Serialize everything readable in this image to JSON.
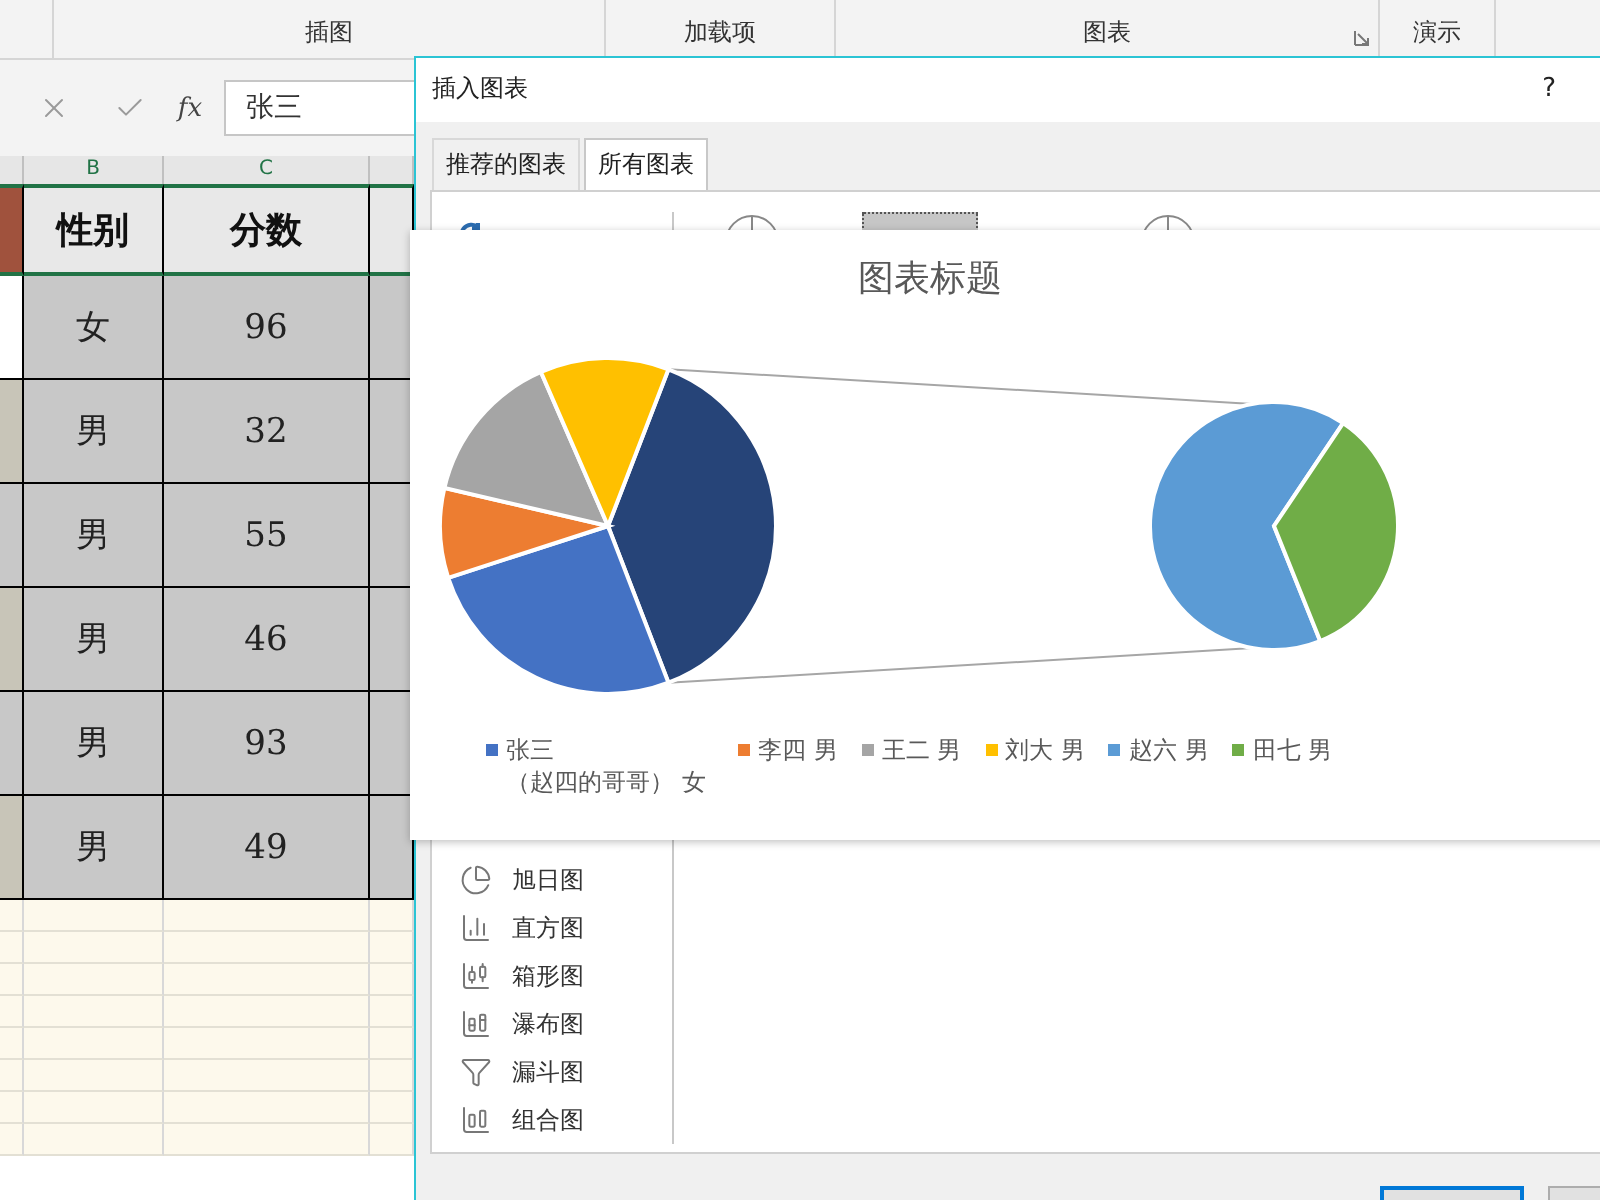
{
  "ribbon": {
    "groups": [
      "插图",
      "加载项",
      "图表",
      "演示"
    ]
  },
  "formula_bar": {
    "fx": "fx",
    "value": "张三"
  },
  "sheet": {
    "column_headers": [
      "B",
      "C"
    ],
    "header": [
      "性别",
      "分数"
    ],
    "rows": [
      {
        "gender": "女",
        "score": "96"
      },
      {
        "gender": "男",
        "score": "32"
      },
      {
        "gender": "男",
        "score": "55"
      },
      {
        "gender": "男",
        "score": "46"
      },
      {
        "gender": "男",
        "score": "93"
      },
      {
        "gender": "男",
        "score": "49"
      }
    ]
  },
  "dialog": {
    "title": "插入图表",
    "help": "?",
    "tabs": [
      {
        "label": "推荐的图表",
        "selected": false
      },
      {
        "label": "所有图表",
        "selected": true
      }
    ],
    "chart_types": [
      "旭日图",
      "直方图",
      "箱形图",
      "瀑布图",
      "漏斗图",
      "组合图"
    ],
    "preview": {
      "title": "图表标题",
      "legend": [
        {
          "label": "张三（赵四的哥哥） 女",
          "color": "#4472c4"
        },
        {
          "label": "李四 男",
          "color": "#ed7d31"
        },
        {
          "label": "王二 男",
          "color": "#a5a5a5"
        },
        {
          "label": "刘大 男",
          "color": "#ffc000"
        },
        {
          "label": "赵六 男",
          "color": "#5b9bd5"
        },
        {
          "label": "田七 男",
          "color": "#70ad47"
        }
      ]
    }
  }
}
